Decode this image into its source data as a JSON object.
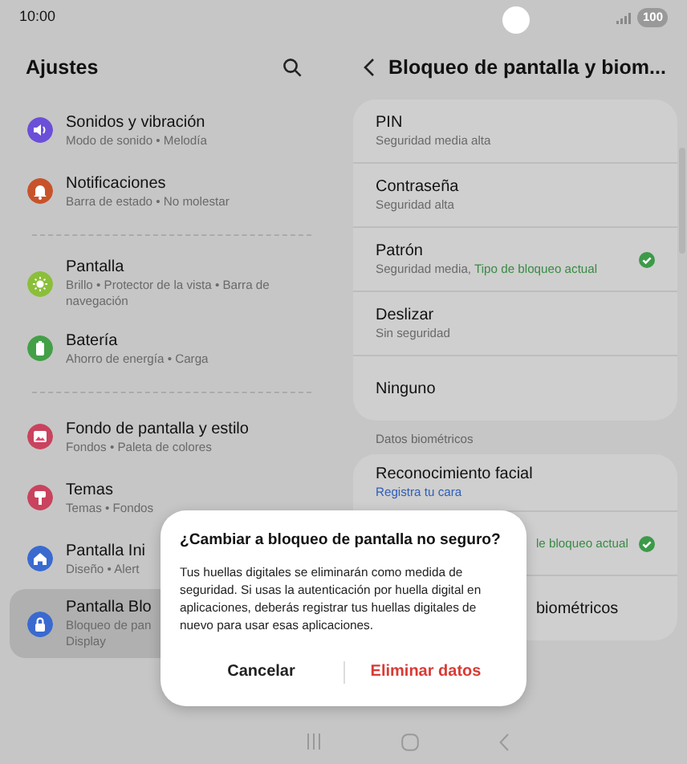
{
  "status_bar": {
    "time": "10:00",
    "battery": "100"
  },
  "settings": {
    "title": "Ajustes",
    "groups": [
      [
        {
          "title": "Sonidos y vibración",
          "subtitle": "Modo de sonido • Melodía",
          "color": "#6b4fd8",
          "kind": "sound",
          "selected": false
        },
        {
          "title": "Notificaciones",
          "subtitle": "Barra de estado • No molestar",
          "color": "#c8532a",
          "kind": "bell",
          "selected": false
        }
      ],
      [
        {
          "title": "Pantalla",
          "subtitle": "Brillo • Protector de la vista • Barra de navegación",
          "color": "#8bbf3a",
          "kind": "sun",
          "selected": false
        },
        {
          "title": "Batería",
          "subtitle": "Ahorro de energía • Carga",
          "color": "#43a047",
          "kind": "battery",
          "selected": false
        }
      ],
      [
        {
          "title": "Fondo de pantalla y estilo",
          "subtitle": "Fondos • Paleta de colores",
          "color": "#c9435e",
          "kind": "image",
          "selected": false
        },
        {
          "title": "Temas",
          "subtitle": "Temas • Fondos",
          "color": "#c9435e",
          "kind": "brush",
          "selected": false
        },
        {
          "title": "Pantalla Ini",
          "subtitle": "Diseño • Alert",
          "color": "#3a6ad0",
          "kind": "home",
          "selected": false
        },
        {
          "title": "Pantalla Blo",
          "subtitle": "Bloqueo de pan\nDisplay",
          "color": "#3a6ad0",
          "kind": "lock",
          "selected": true
        }
      ]
    ]
  },
  "lock_screen": {
    "title": "Bloqueo de pantalla y biom...",
    "types": [
      {
        "title": "PIN",
        "subtitle": "Seguridad media alta",
        "checked": false
      },
      {
        "title": "Contraseña",
        "subtitle": "Seguridad alta",
        "checked": false
      },
      {
        "title": "Patrón",
        "subtitle": "Seguridad media, ",
        "current": "Tipo de bloqueo actual",
        "checked": true
      },
      {
        "title": "Deslizar",
        "subtitle": "Sin seguridad",
        "checked": false
      },
      {
        "title": "Ninguno",
        "checked": false
      }
    ],
    "biometrics_header": "Datos biométricos",
    "biometrics": [
      {
        "title": "Reconocimiento facial",
        "subtitle": "Registra tu cara",
        "kind": "link"
      },
      {
        "subtitle": "le bloqueo actual",
        "kind": "current",
        "checked": true
      },
      {
        "title": "biométricos",
        "kind": "plain"
      }
    ]
  },
  "dialog": {
    "title": "¿Cambiar a bloqueo de pantalla no seguro?",
    "message": "Tus huellas digitales se eliminarán como medida de seguridad. Si usas la autenticación por huella digital en aplicaciones, deberás registrar tus huellas digitales de nuevo para usar esas aplicaciones.",
    "buttons": [
      {
        "label": "Cancelar",
        "kind": "neutral"
      },
      {
        "label": "Eliminar datos",
        "kind": "destructive"
      }
    ]
  }
}
